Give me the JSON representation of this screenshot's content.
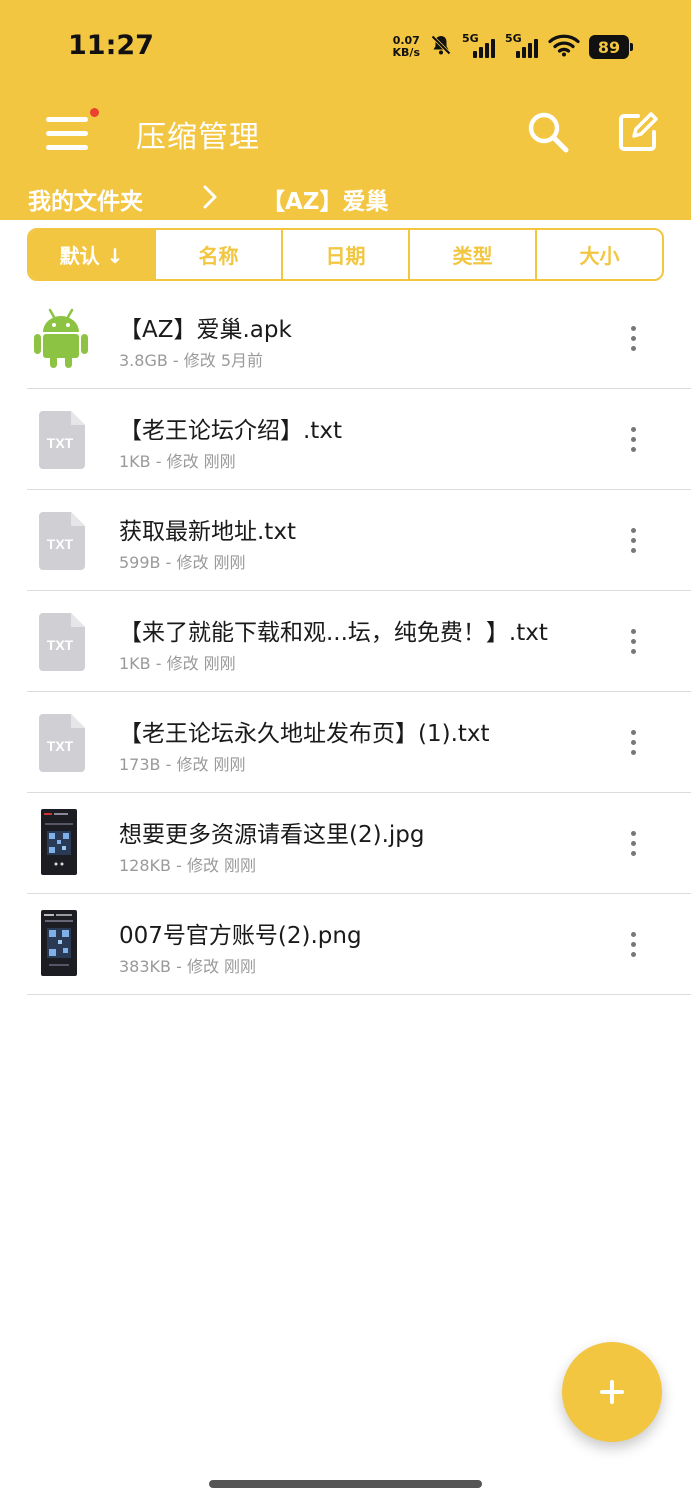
{
  "status_bar": {
    "time": "11:27",
    "net_speed_value": "0.07",
    "net_speed_unit": "KB/s",
    "sim1_tag": "5G",
    "sim2_tag": "5G",
    "battery": "89"
  },
  "toolbar": {
    "title": "压缩管理"
  },
  "breadcrumb": {
    "root": "我的文件夹",
    "current": "【AZ】爱巢"
  },
  "sort_tabs": [
    {
      "label": "默认 ↓",
      "active": true
    },
    {
      "label": "名称",
      "active": false
    },
    {
      "label": "日期",
      "active": false
    },
    {
      "label": "类型",
      "active": false
    },
    {
      "label": "大小",
      "active": false
    }
  ],
  "files": [
    {
      "name": "【AZ】爱巢.apk",
      "meta": "3.8GB - 修改 5月前",
      "icon": "android-icon"
    },
    {
      "name": "【老王论坛介绍】.txt",
      "meta": "1KB - 修改 刚刚",
      "icon": "txt-file-icon",
      "icon_label": "TXT"
    },
    {
      "name": "获取最新地址.txt",
      "meta": "599B - 修改 刚刚",
      "icon": "txt-file-icon",
      "icon_label": "TXT"
    },
    {
      "name": "【来了就能下载和观...坛，纯免费！】.txt",
      "meta": "1KB - 修改 刚刚",
      "icon": "txt-file-icon",
      "icon_label": "TXT"
    },
    {
      "name": "【老王论坛永久地址发布页】(1).txt",
      "meta": "173B - 修改 刚刚",
      "icon": "txt-file-icon",
      "icon_label": "TXT"
    },
    {
      "name": "想要更多资源请看这里(2).jpg",
      "meta": "128KB - 修改 刚刚",
      "icon": "image-thumbnail"
    },
    {
      "name": "007号官方账号(2).png",
      "meta": "383KB - 修改 刚刚",
      "icon": "image-thumbnail"
    }
  ],
  "colors": {
    "accent": "#F2C641",
    "notification_dot": "#E8412E",
    "android_green": "#8DC342",
    "txt_icon_gray": "#D0D0D4"
  }
}
